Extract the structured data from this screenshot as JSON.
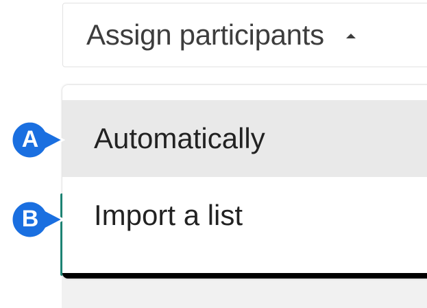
{
  "dropdown": {
    "button_label": "Assign participants",
    "caret_icon": "caret-up-icon"
  },
  "menu": {
    "items": [
      {
        "label": "Automatically",
        "highlighted": true
      },
      {
        "label": "Import a list",
        "highlighted": false
      }
    ]
  },
  "callouts": [
    {
      "letter": "A",
      "color": "#1a6fe0"
    },
    {
      "letter": "B",
      "color": "#1a6fe0"
    }
  ],
  "colors": {
    "accent_teal": "#1f8a7a",
    "callout_blue": "#1a6fe0",
    "highlight_gray": "#e9e9e9"
  }
}
